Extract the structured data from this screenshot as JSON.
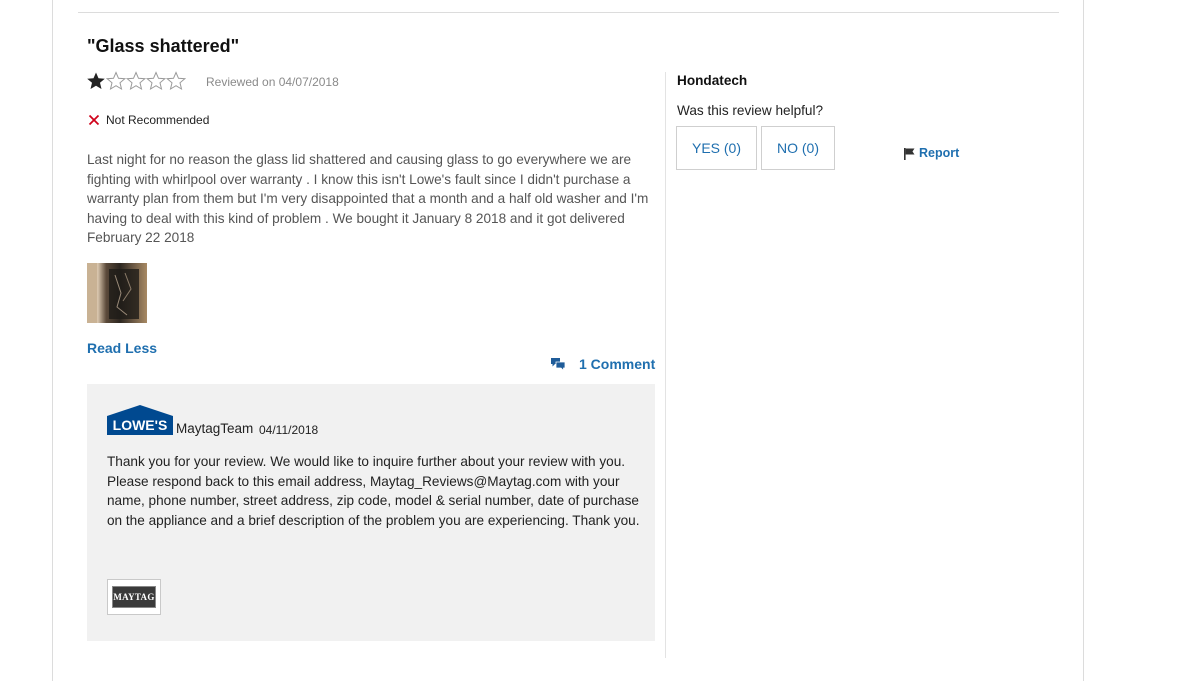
{
  "review": {
    "title": "\"Glass shattered\"",
    "rating": 1,
    "rating_max": 5,
    "date_text": "Reviewed on 04/07/2018",
    "recommendation": "Not Recommended",
    "body": "Last night for no reason the glass lid shattered and causing glass to go everywhere we are fighting with whirlpool over warranty . I know this isn't Lowe's fault since I didn't purchase a warranty plan from them but I'm very disappointed that a month and a half old washer and I'm having to deal with this kind of problem . We bought it January 8 2018 and it got delivered February 22 2018",
    "read_less_label": "Read Less",
    "comments_label": "1 Comment"
  },
  "response": {
    "logo_text": "LOWE'S",
    "responder": "MaytagTeam",
    "date": "04/11/2018",
    "text": "Thank you for your review. We would like to inquire further about your review with you. Please respond back to this email address, Maytag_Reviews@Maytag.com with your name, phone number, street address, zip code, model & serial number, date of purchase on the appliance and a brief description of the problem you are experiencing. Thank you.",
    "badge_text": "MAYTAG"
  },
  "sidebar": {
    "reviewer": "Hondatech",
    "helpful_question": "Was this review helpful?",
    "yes_label": "YES (0)",
    "no_label": "NO (0)",
    "report_label": "Report"
  },
  "colors": {
    "link": "#1f6faf",
    "not_recommended_x": "#d0021b",
    "lowes_blue": "#004990",
    "response_bg": "#f1f1f1"
  },
  "icons": {
    "star_filled": "star-filled-icon",
    "star_empty": "star-empty-icon",
    "not_recommended": "x-icon",
    "comments": "comment-bubbles-icon",
    "report": "flag-icon"
  }
}
